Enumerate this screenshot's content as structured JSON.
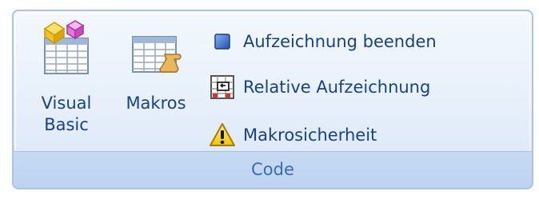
{
  "group": {
    "title": "Code",
    "buttons": {
      "visual_basic": {
        "line1": "Visual",
        "line2": "Basic",
        "icon": "visual-basic-icon"
      },
      "makros": {
        "label": "Makros",
        "icon": "macros-icon"
      }
    },
    "small_buttons": [
      {
        "label": "Aufzeichnung beenden",
        "icon": "stop-recording-icon"
      },
      {
        "label": "Relative Aufzeichnung",
        "icon": "relative-recording-icon"
      },
      {
        "label": "Makrosicherheit",
        "icon": "warning-icon"
      }
    ]
  },
  "colors": {
    "text": "#15428b",
    "footer_text": "#3e6aaa",
    "border": "#a9c4e8"
  }
}
